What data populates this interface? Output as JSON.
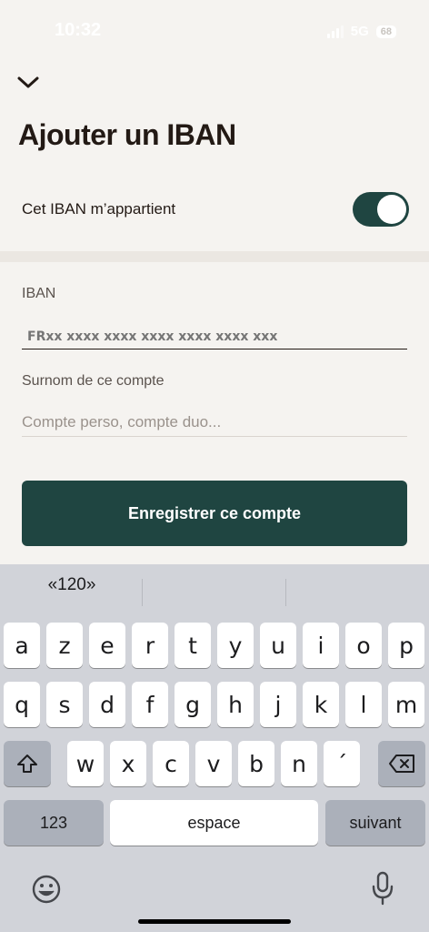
{
  "status_bar": {
    "time": "10:32",
    "network": "5G",
    "battery": "68"
  },
  "header": {
    "back_icon": "chevron-down-icon",
    "title": "Ajouter un IBAN"
  },
  "owner": {
    "label": "Cet IBAN m’appartient",
    "toggle_on": true
  },
  "form": {
    "iban_label": "IBAN",
    "iban_placeholder": "FRxx xxxx xxxx xxxx xxxx xxxx xxx",
    "nickname_label": "Surnom de ce compte",
    "nickname_placeholder": "Compte perso, compte duo..."
  },
  "save_button": {
    "label": "Enregistrer ce compte"
  },
  "keyboard": {
    "suggestions": [
      "«120»",
      "",
      ""
    ],
    "row1": [
      "a",
      "z",
      "e",
      "r",
      "t",
      "y",
      "u",
      "i",
      "o",
      "p"
    ],
    "row2": [
      "q",
      "s",
      "d",
      "f",
      "g",
      "h",
      "j",
      "k",
      "l",
      "m"
    ],
    "row3": [
      "w",
      "x",
      "c",
      "v",
      "b",
      "n",
      "´"
    ],
    "numbers_key": "123",
    "space_key": "espace",
    "next_key": "suivant"
  },
  "colors": {
    "accent": "#1f4541",
    "background": "#f5f3f0",
    "keyboard": "#d1d3d9"
  }
}
